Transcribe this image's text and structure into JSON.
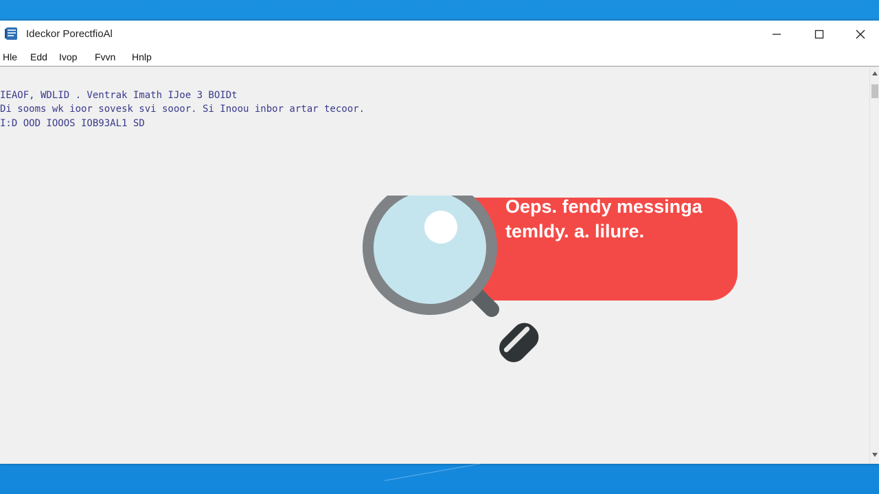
{
  "window": {
    "title": "Ideckor PorectfioAl"
  },
  "menu": {
    "items": [
      "Hle",
      "Edd",
      "Ivop",
      "Fvvn",
      "Hnlp"
    ]
  },
  "content": {
    "lines": [
      "IEAOF, WDLID . Ventrak Imath IJoe 3 BOIDt",
      "Di sooms wk ioor sovesk svi sooor. Si Inoou inbor artar tecoor.",
      "I:D OOD IOOOS IOB93AL1 SD"
    ]
  },
  "error_bubble": {
    "line1": "Oeps. fendy messinga",
    "line2": "temldy. a. lilure.",
    "color": "#f44a47"
  },
  "icons": {
    "app": "notepad-app-icon",
    "magnifier": "magnifying-glass-icon"
  },
  "colors": {
    "desktop": "#1a8fe0",
    "window_bg": "#f0f0f0",
    "text": "#3a3a8c"
  }
}
